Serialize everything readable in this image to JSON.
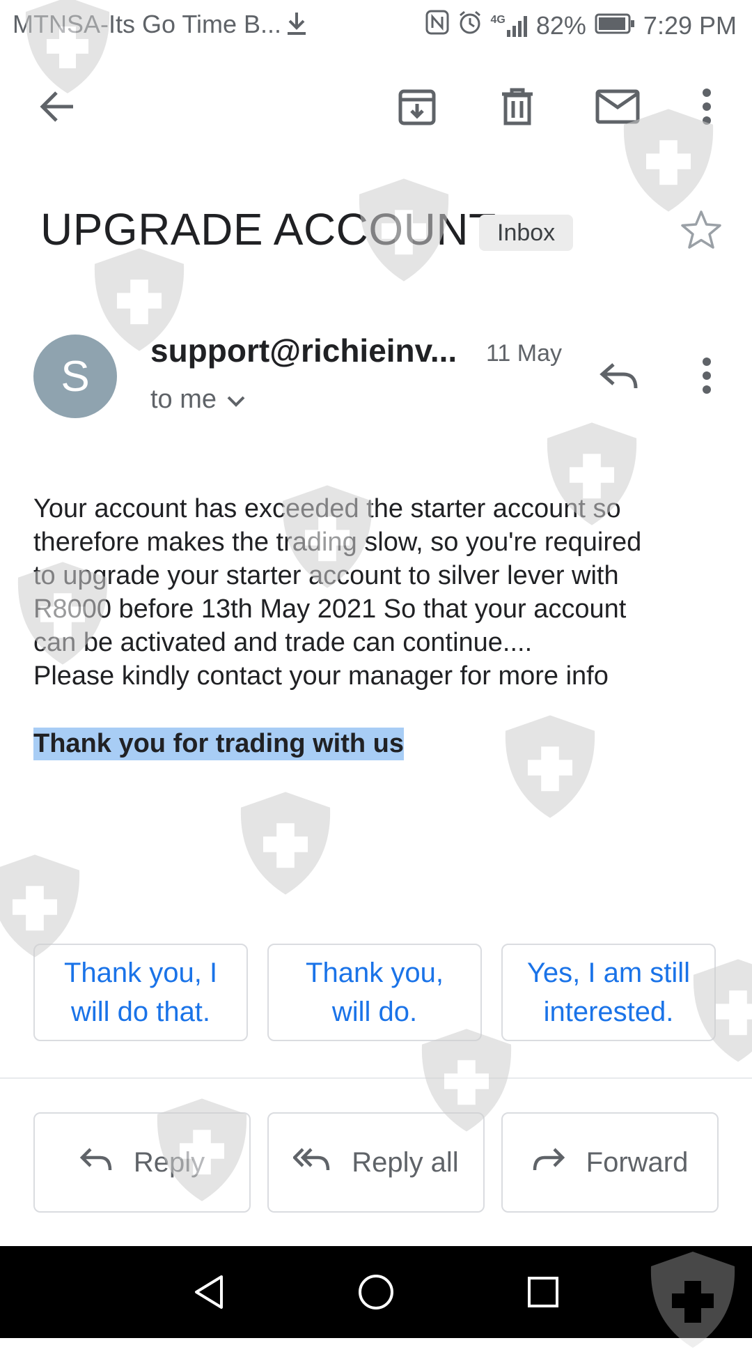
{
  "status_bar": {
    "notification": "MTNSA-Its Go Time B...",
    "network": "4G",
    "battery": "82%",
    "time": "7:29 PM"
  },
  "toolbar": {
    "back": "arrow-left-icon",
    "archive": "archive-icon",
    "delete": "trash-icon",
    "mark_unread": "mail-icon",
    "more": "more-vert-icon"
  },
  "email": {
    "subject": "UPGRADE ACCOUNT",
    "label": "Inbox",
    "sender": "support@richieinv...",
    "avatar_letter": "S",
    "date": "11 May",
    "recipient": "to me",
    "body": [
      "Your account has exceeded the starter account so",
      "therefore makes the trading slow, so you're required",
      "to upgrade your starter account to silver lever with",
      "R8000 before 13th May 2021 So that your account",
      "can be activated and trade can continue....",
      "Please kindly contact your manager for more info"
    ],
    "closing": "Thank you for trading with us"
  },
  "smart_replies": [
    {
      "line1": "Thank you, I",
      "line2": "will do that."
    },
    {
      "line1": "Thank you,",
      "line2": "will do."
    },
    {
      "line1": "Yes, I am still",
      "line2": "interested."
    }
  ],
  "actions": {
    "reply": "Reply",
    "reply_all": "Reply all",
    "forward": "Forward"
  },
  "colors": {
    "accent": "#1a73e8",
    "avatar": "#8fa3af",
    "highlight": "#a8cdf5"
  }
}
